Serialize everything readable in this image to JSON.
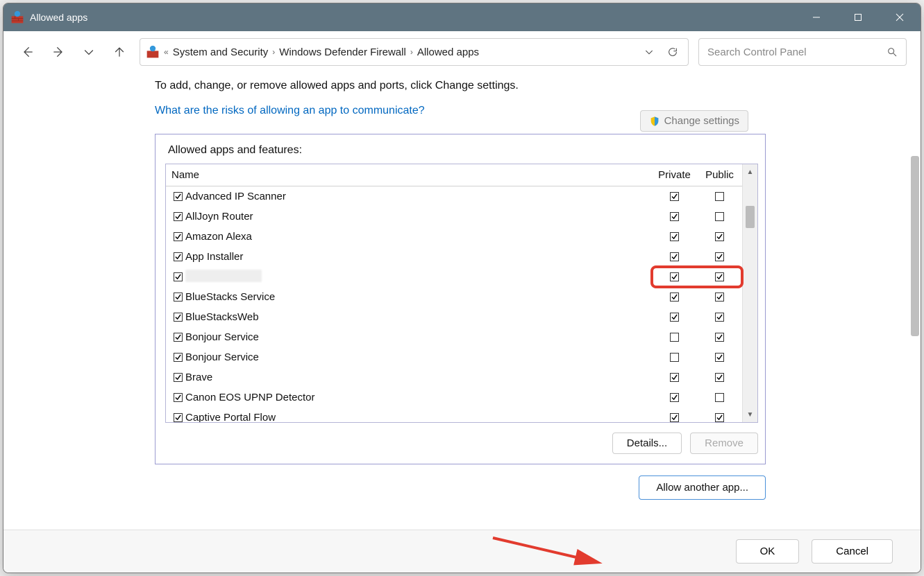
{
  "window": {
    "title": "Allowed apps"
  },
  "breadcrumb": {
    "root": "System and Security",
    "mid": "Windows Defender Firewall",
    "leaf": "Allowed apps"
  },
  "search": {
    "placeholder": "Search Control Panel"
  },
  "intro": "To add, change, or remove allowed apps and ports, click Change settings.",
  "risk_link": "What are the risks of allowing an app to communicate?",
  "change_settings": "Change settings",
  "panel_title": "Allowed apps and features:",
  "columns": {
    "name": "Name",
    "private": "Private",
    "public": "Public"
  },
  "rows": [
    {
      "name": "Advanced IP Scanner",
      "enabled": true,
      "private": true,
      "public": false
    },
    {
      "name": "AllJoyn Router",
      "enabled": true,
      "private": true,
      "public": false
    },
    {
      "name": "Amazon Alexa",
      "enabled": true,
      "private": true,
      "public": true
    },
    {
      "name": "App Installer",
      "enabled": true,
      "private": true,
      "public": true
    },
    {
      "name": "",
      "enabled": true,
      "private": true,
      "public": true,
      "blurred": true,
      "highlight": true
    },
    {
      "name": "BlueStacks Service",
      "enabled": true,
      "private": true,
      "public": true
    },
    {
      "name": "BlueStacksWeb",
      "enabled": true,
      "private": true,
      "public": true
    },
    {
      "name": "Bonjour Service",
      "enabled": true,
      "private": false,
      "public": true
    },
    {
      "name": "Bonjour Service",
      "enabled": true,
      "private": false,
      "public": true
    },
    {
      "name": "Brave",
      "enabled": true,
      "private": true,
      "public": true
    },
    {
      "name": "Canon EOS UPNP Detector",
      "enabled": true,
      "private": true,
      "public": false
    },
    {
      "name": "Captive Portal Flow",
      "enabled": true,
      "private": true,
      "public": true
    }
  ],
  "buttons": {
    "details": "Details...",
    "remove": "Remove",
    "allow_another": "Allow another app...",
    "ok": "OK",
    "cancel": "Cancel"
  }
}
